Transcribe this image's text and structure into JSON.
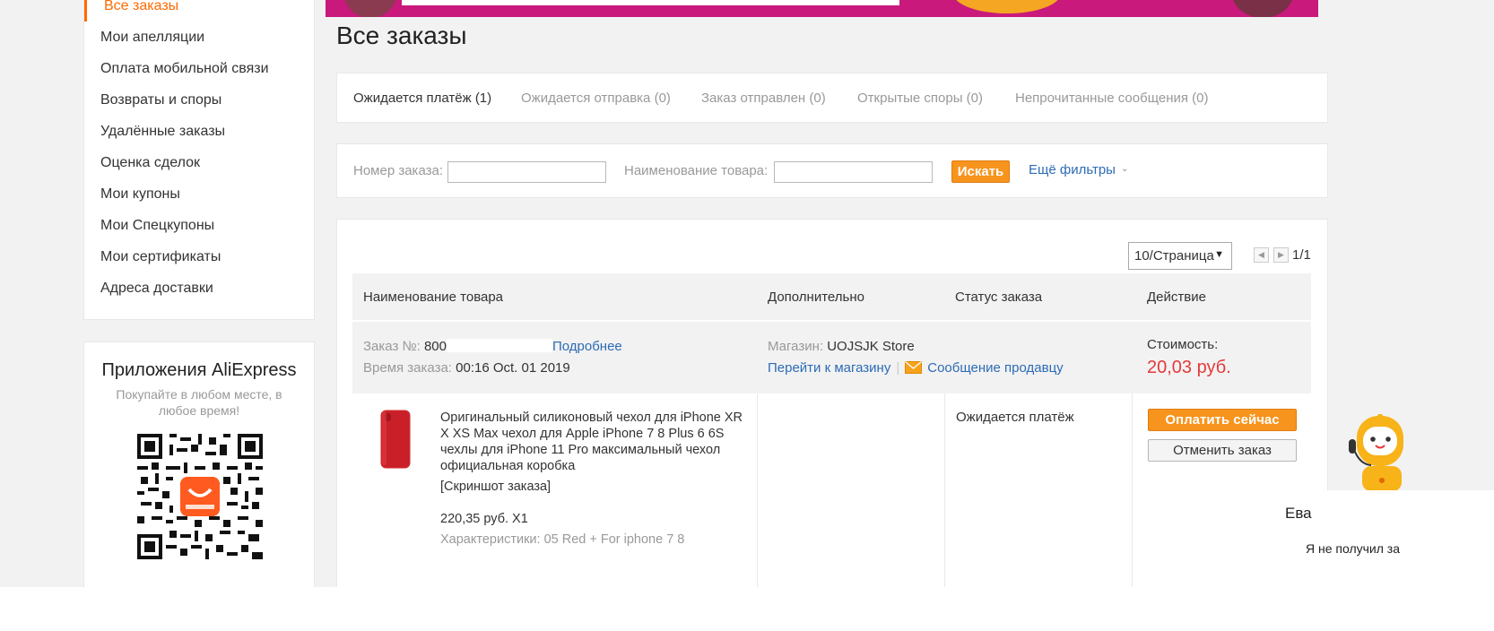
{
  "sidebar": {
    "items": [
      {
        "label": "Все заказы",
        "active": true
      },
      {
        "label": "Мои апелляции"
      },
      {
        "label": "Оплата мобильной связи"
      },
      {
        "label": "Возвраты и споры"
      },
      {
        "label": "Удалённые заказы"
      },
      {
        "label": "Оценка сделок"
      },
      {
        "label": "Мои купоны"
      },
      {
        "label": "Мои Спецкупоны"
      },
      {
        "label": "Мои сертификаты"
      },
      {
        "label": "Адреса доставки"
      }
    ],
    "apps": {
      "title": "Приложения AliExpress",
      "subtitle": "Покупайте в любом месте, в любое время!",
      "qr_label": "AliExpress"
    }
  },
  "page": {
    "title": "Все заказы",
    "accent_color": "#ff6a00",
    "price_color": "#e4393c",
    "link_color": "#2d6bb5"
  },
  "tabs": [
    {
      "label": "Ожидается платёж (1)",
      "active": true
    },
    {
      "label": "Ожидается отправка (0)"
    },
    {
      "label": "Заказ отправлен (0)"
    },
    {
      "label": "Открытые споры (0)"
    },
    {
      "label": "Непрочитанные сообщения (0)"
    }
  ],
  "search": {
    "order_number_label": "Номер заказа:",
    "order_number_value": "",
    "product_name_label": "Наименование товара:",
    "product_name_value": "",
    "search_button": "Искать",
    "more_filters": "Ещё фильтры"
  },
  "pagination": {
    "per_page": "10/Страница",
    "page_count": "1/1"
  },
  "table": {
    "headers": [
      "Наименование товара",
      "Дополнительно",
      "Статус заказа",
      "Действие"
    ]
  },
  "order": {
    "number_label": "Заказ №:",
    "number_prefix": "800",
    "details_link": "Подробнее",
    "time_label": "Время заказа:",
    "time_value": "00:16 Oct. 01 2019",
    "store_label": "Магазин:",
    "store_name": "UOJSJK Store",
    "go_to_store": "Перейти к магазину",
    "message_seller": "Сообщение продавцу",
    "cost_label": "Стоимость:",
    "cost_value": "20,03 руб.",
    "product": {
      "title": "Оригинальный силиконовый чехол для iPhone XR X XS Max чехол для Apple iPhone 7 8 Plus 6 6S чехлы для iPhone 11 Pro максимальный чехол официальная коробка",
      "screenshot_link": "[Скриншот заказа]",
      "price": "220,35 руб. X1",
      "properties": "Характеристики: 05 Red + For iphone 7 8"
    },
    "status": "Ожидается платёж",
    "pay_button": "Оплатить сейчас",
    "cancel_button": "Отменить заказ"
  },
  "chat": {
    "agent_name": "Ева",
    "message_preview": "Я не получил за"
  }
}
